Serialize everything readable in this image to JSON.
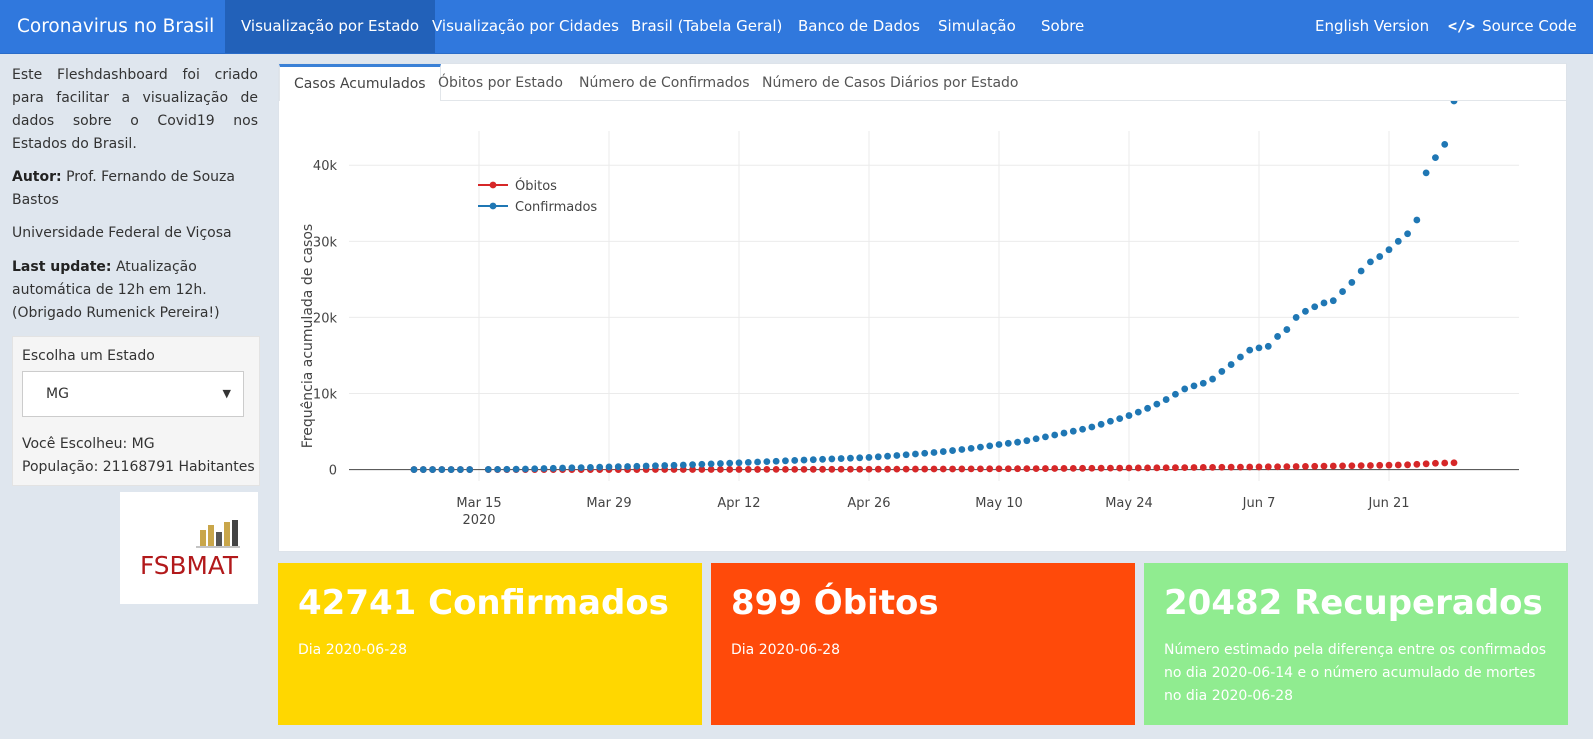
{
  "navbar": {
    "brand": "Coronavirus no Brasil",
    "items": [
      "Visualização por Estado",
      "Visualização por Cidades",
      "Brasil (Tabela Geral)",
      "Banco de Dados",
      "Simulação",
      "Sobre"
    ],
    "english": "English Version",
    "source_code": "Source Code",
    "source_icon": "code-icon"
  },
  "sidebar": {
    "intro": "Este Fleshdashboard foi criado para facilitar a visualização de dados sobre o Covid19 nos Estados do Brasil.",
    "author_label": "Autor:",
    "author": "Prof. Fernando de Souza Bastos",
    "university": "Universidade Federal de Viçosa",
    "update_label": "Last update:",
    "update": "Atualização automática de 12h em 12h. (Obrigado Rumenick Pereira!)",
    "state_label": "Escolha um Estado",
    "state_value": "MG",
    "chosen": "Você Escolheu: MG",
    "population": "População: 21168791 Habitantes",
    "logo_text": "FSBMAT"
  },
  "tabs": [
    "Casos Acumulados",
    "Óbitos por Estado",
    "Número de Confirmados",
    "Número de Casos Diários por Estado"
  ],
  "chart_data": {
    "type": "scatter",
    "ylabel": "Frequência acumulada de casos",
    "xlabel": "",
    "x_ticks": [
      "Mar 15",
      "Mar 29",
      "Apr 12",
      "Apr 26",
      "May 10",
      "May 24",
      "Jun 7",
      "Jun 21"
    ],
    "x_year_label": "2020",
    "y_ticks": [
      "0",
      "10k",
      "20k",
      "30k",
      "40k"
    ],
    "ylim": [
      -1500,
      44500
    ],
    "xlim": [
      "2020-03-01",
      "2020-07-05"
    ],
    "legend_position": "top-left",
    "grid": true,
    "series": [
      {
        "name": "Óbitos",
        "color": "#d62728",
        "dates": [
          "2020-03-08",
          "2020-03-09",
          "2020-03-10",
          "2020-03-11",
          "2020-03-12",
          "2020-03-13",
          "2020-03-14",
          "2020-03-16",
          "2020-03-17",
          "2020-03-18",
          "2020-03-19",
          "2020-03-20",
          "2020-03-21",
          "2020-03-22",
          "2020-03-23",
          "2020-03-24",
          "2020-03-25",
          "2020-03-26",
          "2020-03-27",
          "2020-03-28",
          "2020-03-29",
          "2020-03-30",
          "2020-03-31",
          "2020-04-01",
          "2020-04-02",
          "2020-04-03",
          "2020-04-04",
          "2020-04-05",
          "2020-04-06",
          "2020-04-07",
          "2020-04-08",
          "2020-04-09",
          "2020-04-10",
          "2020-04-11",
          "2020-04-12",
          "2020-04-13",
          "2020-04-14",
          "2020-04-15",
          "2020-04-16",
          "2020-04-17",
          "2020-04-18",
          "2020-04-19",
          "2020-04-20",
          "2020-04-21",
          "2020-04-22",
          "2020-04-23",
          "2020-04-24",
          "2020-04-25",
          "2020-04-26",
          "2020-04-27",
          "2020-04-28",
          "2020-04-29",
          "2020-04-30",
          "2020-05-01",
          "2020-05-02",
          "2020-05-03",
          "2020-05-04",
          "2020-05-05",
          "2020-05-06",
          "2020-05-07",
          "2020-05-08",
          "2020-05-09",
          "2020-05-10",
          "2020-05-11",
          "2020-05-12",
          "2020-05-13",
          "2020-05-14",
          "2020-05-15",
          "2020-05-16",
          "2020-05-17",
          "2020-05-18",
          "2020-05-19",
          "2020-05-20",
          "2020-05-21",
          "2020-05-22",
          "2020-05-23",
          "2020-05-24",
          "2020-05-25",
          "2020-05-26",
          "2020-05-27",
          "2020-05-28",
          "2020-05-29",
          "2020-05-30",
          "2020-05-31",
          "2020-06-01",
          "2020-06-02",
          "2020-06-03",
          "2020-06-04",
          "2020-06-05",
          "2020-06-06",
          "2020-06-07",
          "2020-06-08",
          "2020-06-09",
          "2020-06-10",
          "2020-06-11",
          "2020-06-12",
          "2020-06-13",
          "2020-06-14",
          "2020-06-15",
          "2020-06-16",
          "2020-06-17",
          "2020-06-18",
          "2020-06-19",
          "2020-06-20",
          "2020-06-21",
          "2020-06-22",
          "2020-06-23",
          "2020-06-24",
          "2020-06-25",
          "2020-06-26",
          "2020-06-27",
          "2020-06-28"
        ],
        "values": [
          0,
          0,
          0,
          0,
          0,
          0,
          0,
          0,
          0,
          0,
          0,
          0,
          0,
          0,
          0,
          1,
          1,
          2,
          2,
          3,
          4,
          4,
          5,
          6,
          7,
          8,
          9,
          10,
          11,
          12,
          13,
          14,
          15,
          17,
          18,
          20,
          22,
          24,
          26,
          28,
          30,
          32,
          34,
          36,
          38,
          40,
          43,
          46,
          49,
          52,
          55,
          58,
          62,
          66,
          70,
          74,
          78,
          82,
          87,
          92,
          97,
          102,
          107,
          113,
          119,
          125,
          131,
          137,
          144,
          151,
          158,
          165,
          173,
          181,
          189,
          197,
          205,
          214,
          223,
          232,
          241,
          251,
          261,
          271,
          281,
          292,
          303,
          314,
          326,
          338,
          350,
          363,
          376,
          390,
          405,
          420,
          436,
          452,
          468,
          485,
          503,
          521,
          540,
          560,
          580,
          602,
          625,
          690,
          760,
          830,
          870,
          899
        ]
      },
      {
        "name": "Confirmados",
        "color": "#1f77b4",
        "dates": [
          "2020-03-08",
          "2020-03-09",
          "2020-03-10",
          "2020-03-11",
          "2020-03-12",
          "2020-03-13",
          "2020-03-14",
          "2020-03-16",
          "2020-03-17",
          "2020-03-18",
          "2020-03-19",
          "2020-03-20",
          "2020-03-21",
          "2020-03-22",
          "2020-03-23",
          "2020-03-24",
          "2020-03-25",
          "2020-03-26",
          "2020-03-27",
          "2020-03-28",
          "2020-03-29",
          "2020-03-30",
          "2020-03-31",
          "2020-04-01",
          "2020-04-02",
          "2020-04-03",
          "2020-04-04",
          "2020-04-05",
          "2020-04-06",
          "2020-04-07",
          "2020-04-08",
          "2020-04-09",
          "2020-04-10",
          "2020-04-11",
          "2020-04-12",
          "2020-04-13",
          "2020-04-14",
          "2020-04-15",
          "2020-04-16",
          "2020-04-17",
          "2020-04-18",
          "2020-04-19",
          "2020-04-20",
          "2020-04-21",
          "2020-04-22",
          "2020-04-23",
          "2020-04-24",
          "2020-04-25",
          "2020-04-26",
          "2020-04-27",
          "2020-04-28",
          "2020-04-29",
          "2020-04-30",
          "2020-05-01",
          "2020-05-02",
          "2020-05-03",
          "2020-05-04",
          "2020-05-05",
          "2020-05-06",
          "2020-05-07",
          "2020-05-08",
          "2020-05-09",
          "2020-05-10",
          "2020-05-11",
          "2020-05-12",
          "2020-05-13",
          "2020-05-14",
          "2020-05-15",
          "2020-05-16",
          "2020-05-17",
          "2020-05-18",
          "2020-05-19",
          "2020-05-20",
          "2020-05-21",
          "2020-05-22",
          "2020-05-23",
          "2020-05-24",
          "2020-05-25",
          "2020-05-26",
          "2020-05-27",
          "2020-05-28",
          "2020-05-29",
          "2020-05-30",
          "2020-05-31",
          "2020-06-01",
          "2020-06-02",
          "2020-06-03",
          "2020-06-04",
          "2020-06-05",
          "2020-06-06",
          "2020-06-07",
          "2020-06-08",
          "2020-06-09",
          "2020-06-10",
          "2020-06-11",
          "2020-06-12",
          "2020-06-13",
          "2020-06-14",
          "2020-06-15",
          "2020-06-16",
          "2020-06-17",
          "2020-06-18",
          "2020-06-19",
          "2020-06-20",
          "2020-06-21",
          "2020-06-22",
          "2020-06-23",
          "2020-06-24",
          "2020-06-25",
          "2020-06-26",
          "2020-06-27",
          "2020-06-28"
        ],
        "values": [
          1,
          1,
          2,
          2,
          3,
          3,
          4,
          20,
          30,
          40,
          55,
          80,
          110,
          140,
          170,
          200,
          230,
          260,
          290,
          320,
          350,
          380,
          410,
          440,
          470,
          500,
          530,
          560,
          600,
          650,
          700,
          750,
          800,
          850,
          900,
          950,
          1000,
          1050,
          1100,
          1150,
          1200,
          1250,
          1300,
          1350,
          1400,
          1450,
          1500,
          1550,
          1600,
          1680,
          1760,
          1850,
          1950,
          2050,
          2150,
          2250,
          2370,
          2500,
          2640,
          2790,
          2950,
          3120,
          3300,
          3450,
          3600,
          3800,
          4050,
          4300,
          4550,
          4800,
          5050,
          5300,
          5600,
          5950,
          6350,
          6700,
          7100,
          7550,
          8050,
          8600,
          9200,
          9900,
          10600,
          11000,
          11350,
          11900,
          12900,
          13800,
          14800,
          15700,
          16000,
          16200,
          17500,
          18400,
          20000,
          20800,
          21400,
          21900,
          22200,
          23400,
          24600,
          26100,
          27300,
          28000,
          28900,
          30000,
          31000,
          32800,
          39000,
          41000,
          42741
        ]
      }
    ]
  },
  "valueboxes": [
    {
      "big": "42741 Confirmados",
      "small": "Dia 2020-06-28",
      "color": "#ffd700"
    },
    {
      "big": "899 Óbitos",
      "small": "Dia 2020-06-28",
      "color": "#ff4a0a"
    },
    {
      "big": "20482 Recuperados",
      "small": "Número estimado pela diferença entre os confirmados no dia 2020-06-14 e o número acumulado de mortes no dia 2020-06-28",
      "color": "#90ec90"
    }
  ]
}
